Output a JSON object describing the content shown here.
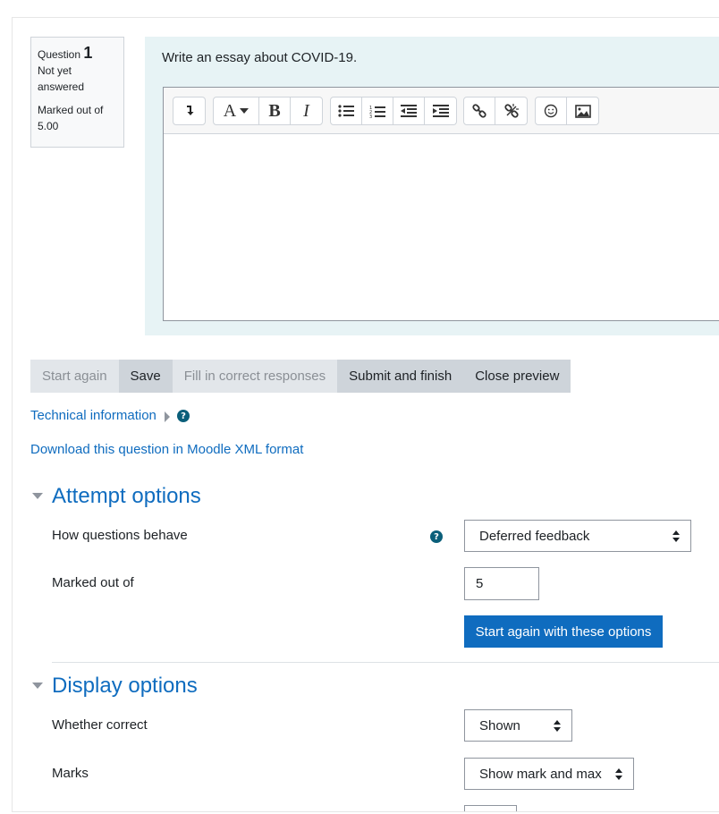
{
  "question": {
    "label": "Question",
    "number": "1",
    "status_line1": "Not yet",
    "status_line2": "answered",
    "mark_line1": "Marked out of",
    "mark_line2": "5.00",
    "text": "Write an essay about COVID-19."
  },
  "editor": {
    "toolbar_icons": [
      "collapse-icon",
      "font-style-icon",
      "bold-icon",
      "italic-icon",
      "unordered-list-icon",
      "ordered-list-icon",
      "outdent-icon",
      "indent-icon",
      "link-icon",
      "unlink-icon",
      "emoji-icon",
      "image-icon"
    ],
    "font_glyph": "A",
    "bold_glyph": "B",
    "italic_glyph": "I"
  },
  "actions": {
    "start_again": "Start again",
    "save": "Save",
    "fill_correct": "Fill in correct responses",
    "submit_finish": "Submit and finish",
    "close_preview": "Close preview"
  },
  "links": {
    "technical_info": "Technical information",
    "download_xml": "Download this question in Moodle XML format"
  },
  "attempt_options": {
    "title": "Attempt options",
    "behave_label": "How questions behave",
    "behave_value": "Deferred feedback",
    "marked_label": "Marked out of",
    "marked_value": "5",
    "start_again_button": "Start again with these options"
  },
  "display_options": {
    "title": "Display options",
    "correct_label": "Whether correct",
    "correct_value": "Shown",
    "marks_label": "Marks",
    "marks_value": "Show mark and max"
  },
  "colors": {
    "link": "#0f6cbf",
    "primary": "#0f6cbf",
    "question_bg": "#e7f3f5",
    "help_icon": "#0b5f7a"
  }
}
